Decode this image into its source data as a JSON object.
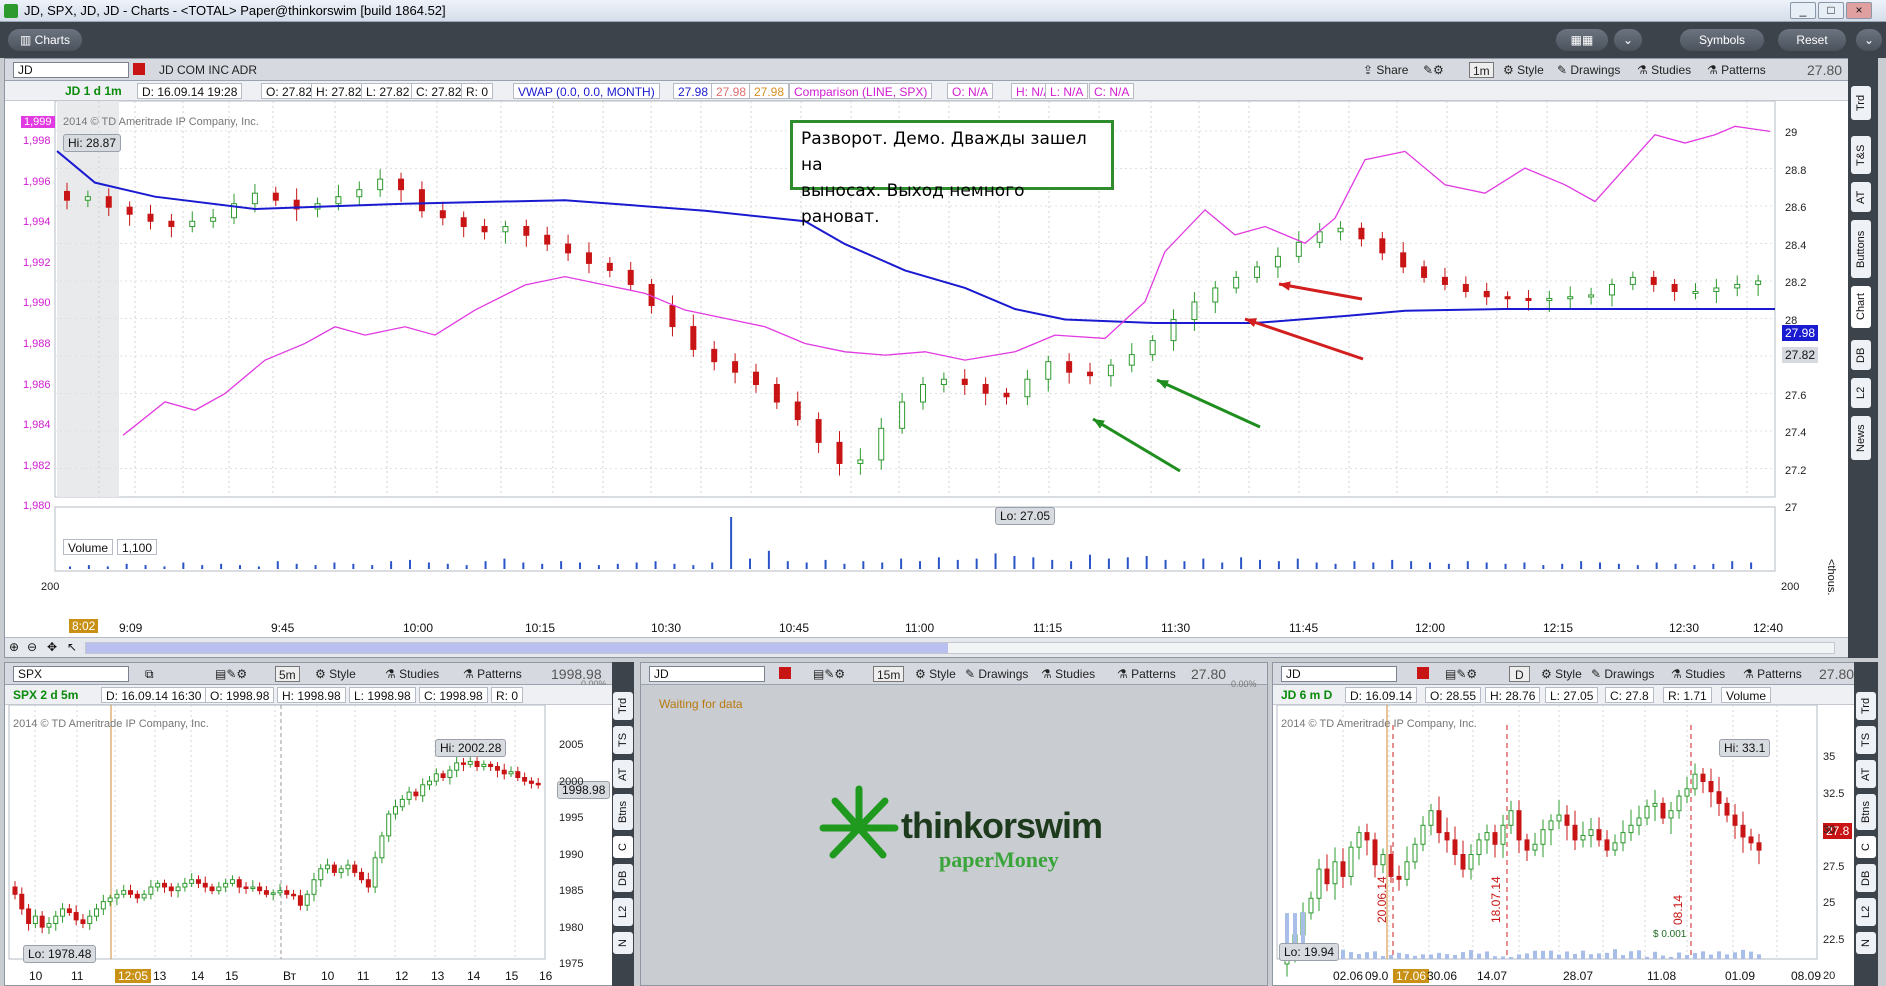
{
  "window": {
    "title": "JD, SPX, JD, JD - Charts - <TOTAL> Paper@thinkorswim [build 1864.52]",
    "controls": [
      "_",
      "□",
      "×"
    ]
  },
  "toolbar": {
    "tab": "Charts",
    "symbols_label": "Symbols",
    "reset_label": "Reset"
  },
  "main": {
    "symbol": "JD",
    "company": "JD COM INC ADR",
    "header_buttons": [
      "Share",
      "1m",
      "Style",
      "Drawings",
      "Studies",
      "Patterns"
    ],
    "last_price": "27.80",
    "info": {
      "name": "JD 1 d 1m",
      "date": "D: 16.09.14 19:28",
      "open": "O: 27.82",
      "high": "H: 27.82",
      "low": "L: 27.82",
      "close": "C: 27.82",
      "range": "R: 0",
      "vwap": "VWAP (0.0, 0.0, MONTH)",
      "vwap_v1": "27.98",
      "vwap_v2": "27.98",
      "vwap_v3": "27.98",
      "comparison": "Comparison (LINE, SPX)",
      "cmp_o": "O: N/A",
      "cmp_h": "H: N/A",
      "cmp_l": "L: N/A",
      "cmp_c": "C: N/A"
    },
    "copyright": "2014 © TD Ameritrade IP Company, Inc.",
    "hi_label": "Hi: 28.87",
    "lo_label": "Lo: 27.05",
    "spx_top_label": "1,999",
    "left_axis": [
      "1,998",
      "1,996",
      "1,994",
      "1,992",
      "1,990",
      "1,988",
      "1,986",
      "1,984",
      "1,982",
      "1,980"
    ],
    "right_axis": [
      "29",
      "28.8",
      "28.6",
      "28.4",
      "28.2",
      "28",
      "27.8",
      "27.6",
      "27.4",
      "27.2",
      "27"
    ],
    "price_tag_blue": "27.98",
    "price_tag_gray": "27.82",
    "annotation_lines": [
      "Разворот. Демо. Дважды зашел на",
      "выносах. Выход немного рановат."
    ],
    "volume_label": "Volume",
    "volume_value": "1,100",
    "volume_ticks": [
      "200",
      "200"
    ],
    "volume_unit": "<thous.",
    "time_start_tag": "8:02",
    "time_axis": [
      "9:09",
      "9:45",
      "10:00",
      "10:15",
      "10:30",
      "10:45",
      "11:00",
      "11:15",
      "11:30",
      "11:45",
      "12:00",
      "12:15",
      "12:30",
      "12:40"
    ],
    "side_buttons": [
      "Trd",
      "T&S",
      "AT",
      "Buttons",
      "Chart",
      "DB",
      "L2",
      "News"
    ]
  },
  "spx_panel": {
    "symbol": "SPX",
    "header_buttons": [
      "5m",
      "Style",
      "Studies",
      "Patterns"
    ],
    "last_price": "1998.98",
    "change": "0.00%",
    "info": {
      "name": "SPX 2 d 5m",
      "date": "D: 16.09.14 16:30",
      "open": "O: 1998.98",
      "high": "H: 1998.98",
      "low": "L: 1998.98",
      "close": "C: 1998.98",
      "range": "R: 0"
    },
    "copyright": "2014 © TD Ameritrade IP Company, Inc.",
    "hi_label": "Hi: 2002.28",
    "lo_label": "Lo: 1978.48",
    "price_tag": "1998.98",
    "axis": [
      "2005",
      "2000",
      "1995",
      "1990",
      "1985",
      "1980",
      "1975"
    ],
    "time_tag": "12:05",
    "time_axis": [
      "10",
      "11",
      "13",
      "14",
      "15",
      "Вт",
      "10",
      "11",
      "12",
      "13",
      "14",
      "15",
      "16"
    ],
    "side_buttons": [
      "Trd",
      "TS",
      "AT",
      "Btns",
      "C",
      "DB",
      "L2",
      "N"
    ]
  },
  "middle_panel": {
    "symbol": "JD",
    "header_buttons": [
      "15m",
      "Style",
      "Drawings",
      "Studies",
      "Patterns"
    ],
    "last_price": "27.80",
    "change": "0.00%",
    "status": "Waiting for data",
    "logo_text": "thinkorswim",
    "logo_sub": "paperMoney"
  },
  "jd_daily_panel": {
    "symbol": "JD",
    "header_buttons": [
      "D",
      "Style",
      "Drawings",
      "Studies",
      "Patterns"
    ],
    "last_price": "27.80",
    "change": "0.00%",
    "info": {
      "name": "JD 6 m D",
      "date": "D: 16.09.14",
      "open": "O: 28.55",
      "high": "H: 28.76",
      "low": "L: 27.05",
      "close": "C: 27.8",
      "range": "R: 1.71",
      "volume": "Volume"
    },
    "copyright": "2014 © TD Ameritrade IP Company, Inc.",
    "hi_label": "Hi: 33.1",
    "lo_label": "Lo: 19.94",
    "price_tag": "27.8",
    "axis": [
      "35",
      "32.5",
      "30",
      "27.5",
      "25",
      "22.5",
      "20"
    ],
    "date_markers": [
      "20.06.14",
      "18.07.14",
      "08.14"
    ],
    "marker_value": "$ 0.001",
    "time_tag": "17.06",
    "time_axis": [
      "02.06",
      "09.0",
      "30.06",
      "14.07",
      "28.07",
      "11.08",
      "01.09",
      "08.09"
    ],
    "side_buttons": [
      "Trd",
      "TS",
      "AT",
      "Btns",
      "C",
      "DB",
      "L2",
      "N"
    ]
  },
  "colors": {
    "candle_up": "#2e9a2e",
    "candle_down": "#c81414",
    "vwap_line": "#1a1ad0",
    "comparison_line": "#e23ae2",
    "annotation_border": "#2e8b2e"
  }
}
